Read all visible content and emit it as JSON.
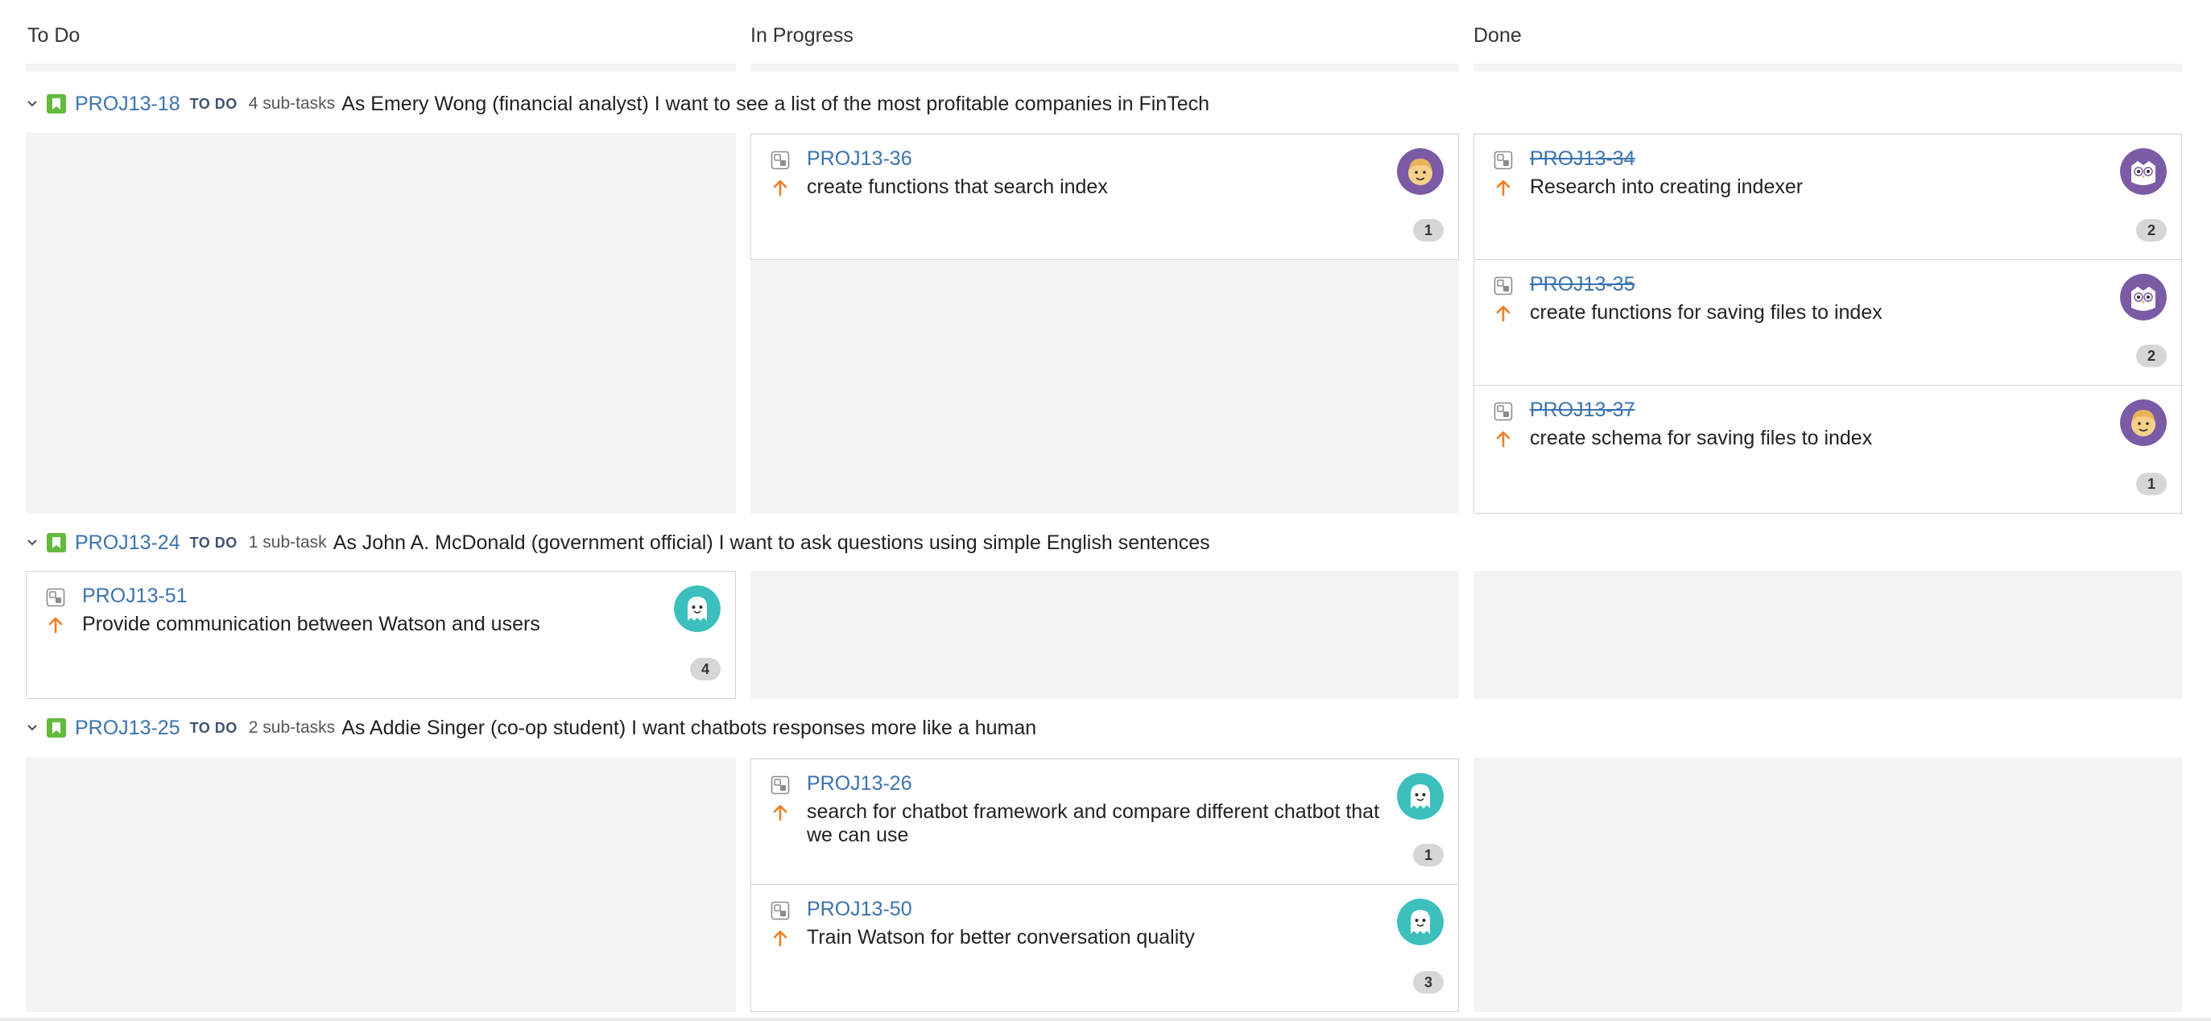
{
  "columns": [
    {
      "title": "To Do"
    },
    {
      "title": "In Progress"
    },
    {
      "title": "Done"
    }
  ],
  "swimlanes": [
    {
      "key": "PROJ13-18",
      "status": "TO DO",
      "subtasks": "4 sub-tasks",
      "summary": "As Emery Wong (financial analyst) I want to see a list of the most profitable companies in FinTech",
      "cards": [
        {
          "key": "PROJ13-36",
          "summary": "create functions that search index",
          "badge": "1",
          "avatar": "avatar-yellow-face",
          "column": "In Progress"
        },
        {
          "key": "PROJ13-34",
          "summary": "Research into creating indexer",
          "badge": "2",
          "avatar": "avatar-purple-owl",
          "column": "Done"
        },
        {
          "key": "PROJ13-35",
          "summary": "create functions for saving files to index",
          "badge": "2",
          "avatar": "avatar-purple-owl",
          "column": "Done"
        },
        {
          "key": "PROJ13-37",
          "summary": "create schema for saving files to index",
          "badge": "1",
          "avatar": "avatar-yellow-face",
          "column": "Done"
        }
      ]
    },
    {
      "key": "PROJ13-24",
      "status": "TO DO",
      "subtasks": "1 sub-task",
      "summary": "As John A. McDonald (government official) I want to ask questions using simple English sentences",
      "cards": [
        {
          "key": "PROJ13-51",
          "summary": "Provide communication between Watson and users",
          "badge": "4",
          "avatar": "avatar-teal-ghost",
          "column": "To Do"
        }
      ]
    },
    {
      "key": "PROJ13-25",
      "status": "TO DO",
      "subtasks": "2 sub-tasks",
      "summary": "As Addie Singer (co-op student) I want chatbots responses more like a human",
      "cards": [
        {
          "key": "PROJ13-26",
          "summary": "search for chatbot framework and compare different chatbot that we can use",
          "badge": "1",
          "avatar": "avatar-teal-ghost",
          "column": "In Progress"
        },
        {
          "key": "PROJ13-50",
          "summary": "Train Watson for better conversation quality",
          "badge": "3",
          "avatar": "avatar-teal-ghost",
          "column": "In Progress"
        }
      ]
    }
  ],
  "colors": {
    "link": "#3b73af",
    "story": "#63ba3c",
    "priority": "#f07d21",
    "cell_bg": "#f4f4f4",
    "avatar_purple": "#7b5aa6",
    "avatar_teal": "#3cbfbd"
  },
  "icons": {
    "swimlane_toggle": "chevron-down-icon",
    "issue_type_story": "story-icon",
    "issue_type_subtask": "subtask-icon",
    "priority": "priority-major-arrow-up-icon"
  }
}
